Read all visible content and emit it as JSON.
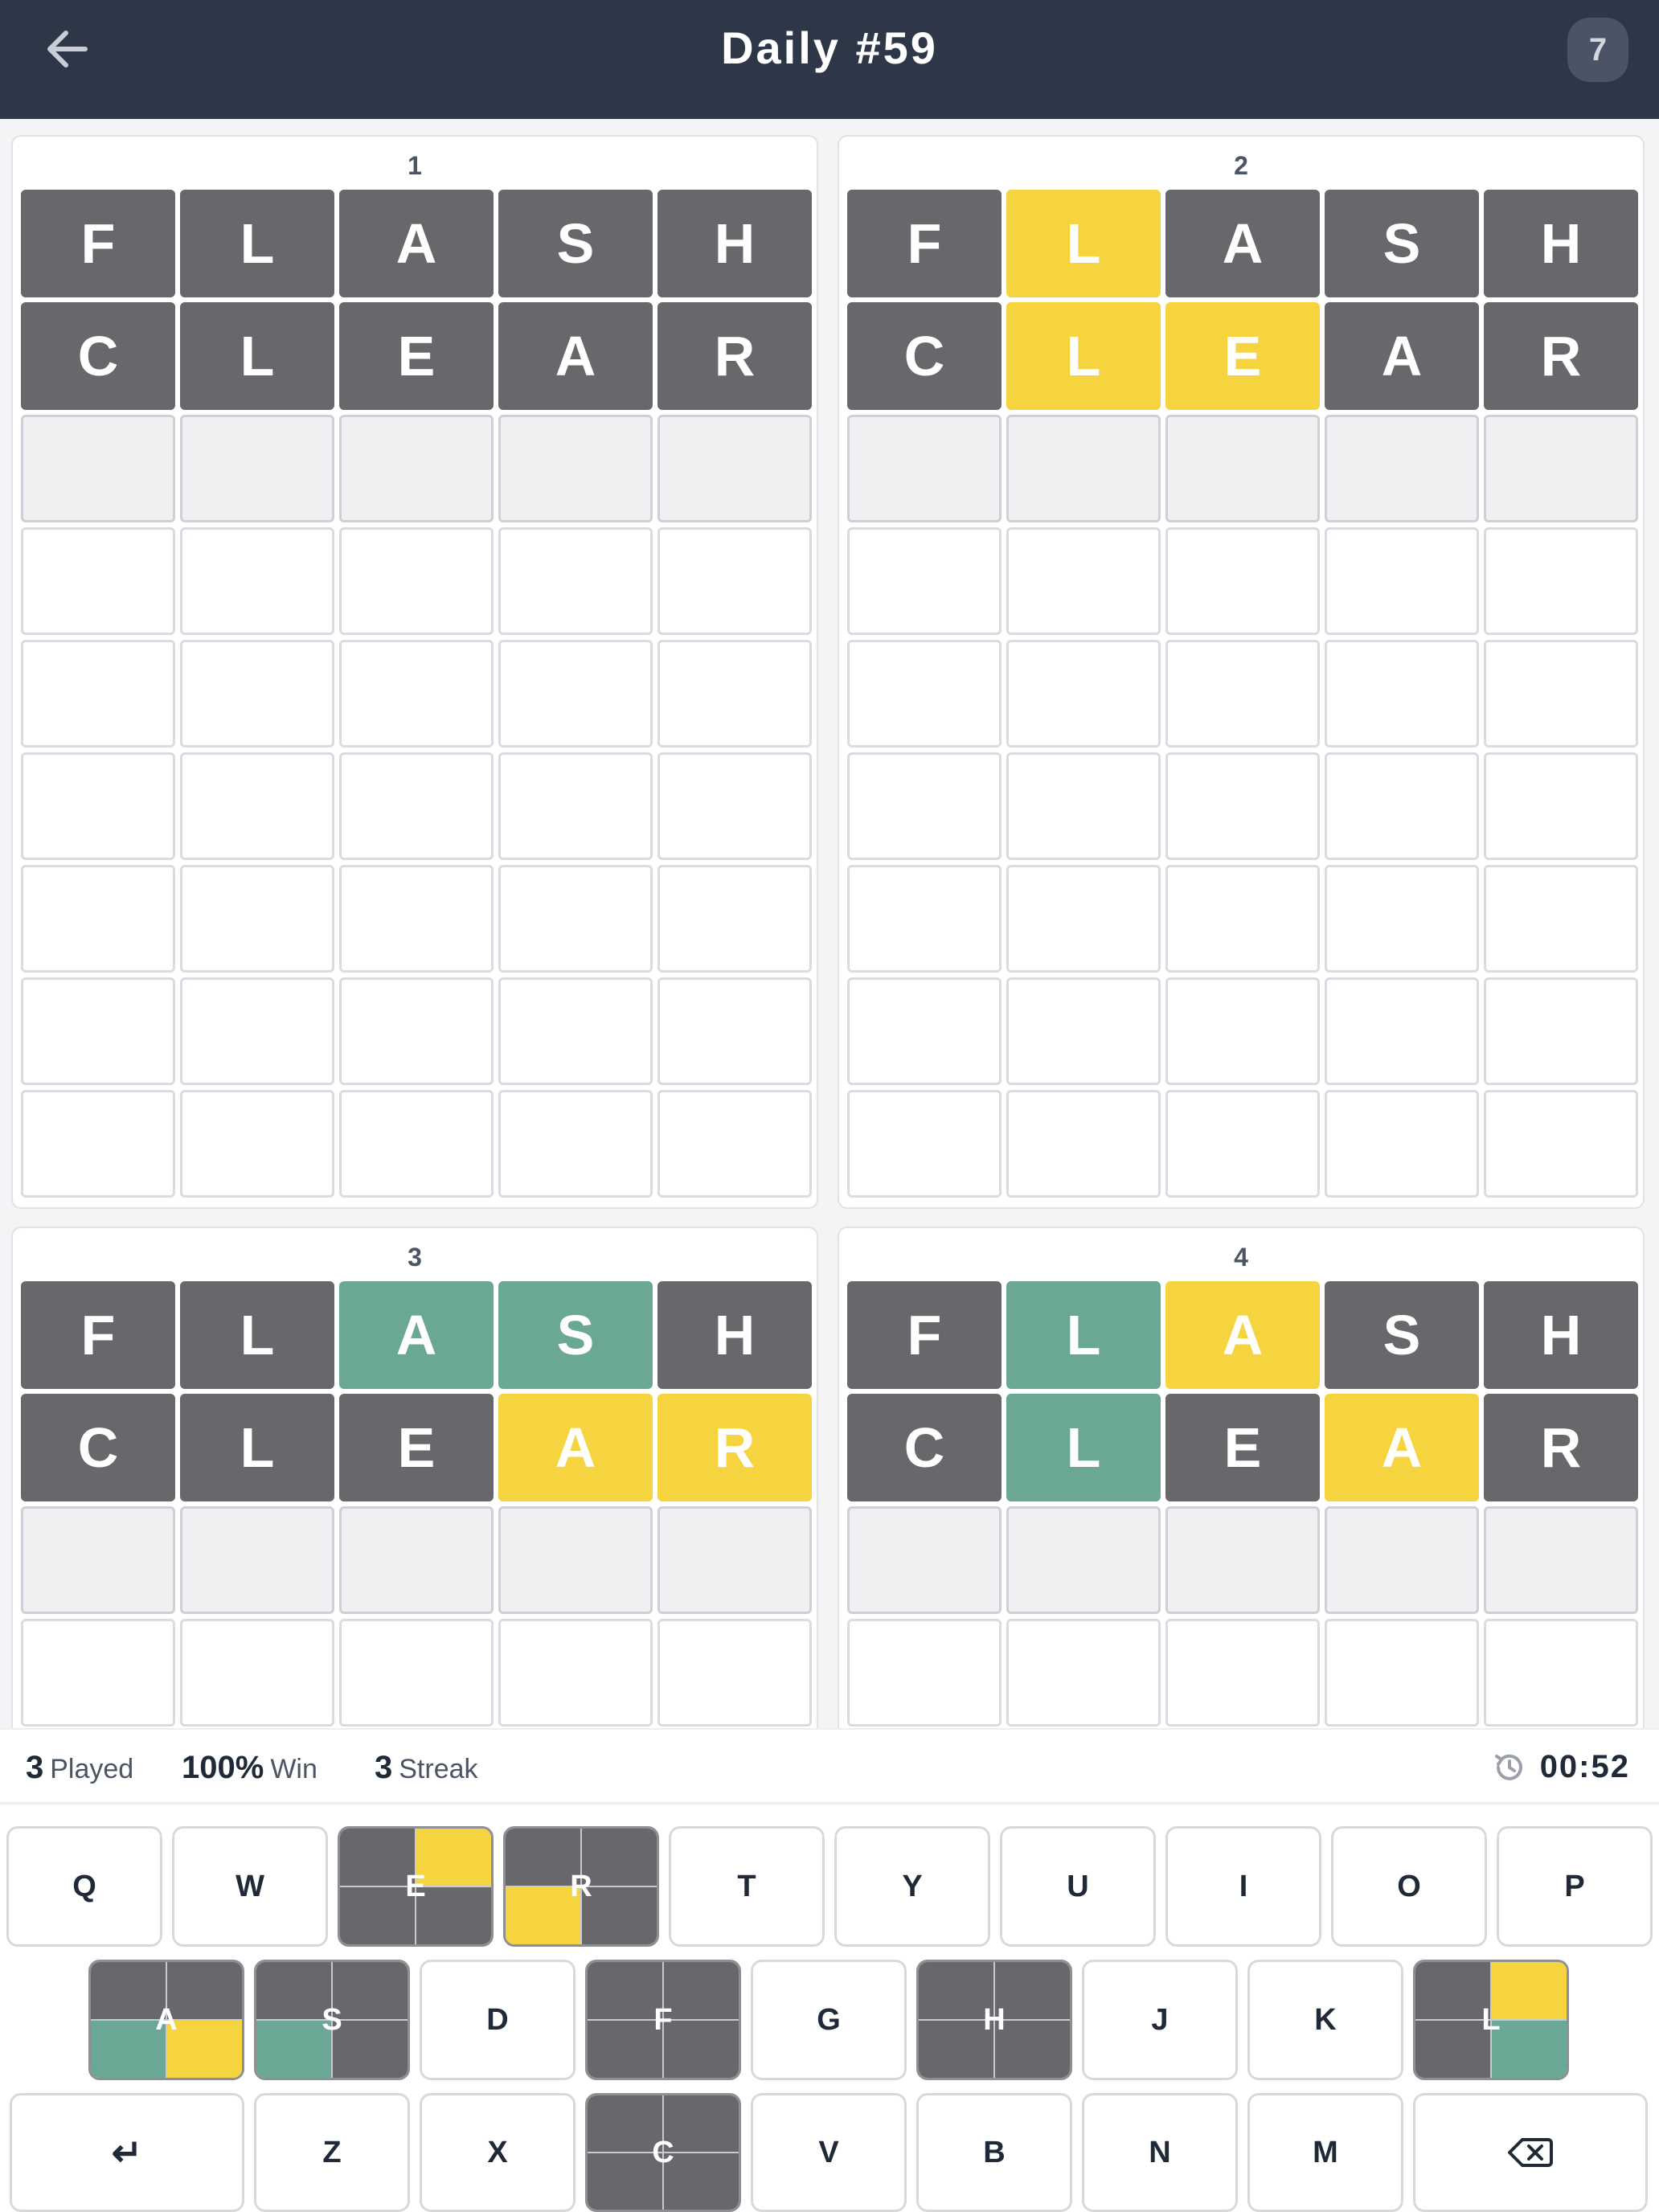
{
  "header": {
    "title": "Daily #59",
    "badge": "7",
    "back_icon": "arrow-left-icon"
  },
  "colors": {
    "gray": "#68686c",
    "yellow": "#f6d440",
    "green": "#6aa895",
    "header_bg": "#2e3748"
  },
  "boards": [
    {
      "number": "1",
      "rows": [
        {
          "letters": [
            "F",
            "L",
            "A",
            "S",
            "H"
          ],
          "states": [
            "gray",
            "gray",
            "gray",
            "gray",
            "gray"
          ]
        },
        {
          "letters": [
            "C",
            "L",
            "E",
            "A",
            "R"
          ],
          "states": [
            "gray",
            "gray",
            "gray",
            "gray",
            "gray"
          ]
        }
      ],
      "current_row": 2,
      "total_rows": 9
    },
    {
      "number": "2",
      "rows": [
        {
          "letters": [
            "F",
            "L",
            "A",
            "S",
            "H"
          ],
          "states": [
            "gray",
            "yellow",
            "gray",
            "gray",
            "gray"
          ]
        },
        {
          "letters": [
            "C",
            "L",
            "E",
            "A",
            "R"
          ],
          "states": [
            "gray",
            "yellow",
            "yellow",
            "gray",
            "gray"
          ]
        }
      ],
      "current_row": 2,
      "total_rows": 9
    },
    {
      "number": "3",
      "rows": [
        {
          "letters": [
            "F",
            "L",
            "A",
            "S",
            "H"
          ],
          "states": [
            "gray",
            "gray",
            "green",
            "green",
            "gray"
          ]
        },
        {
          "letters": [
            "C",
            "L",
            "E",
            "A",
            "R"
          ],
          "states": [
            "gray",
            "gray",
            "gray",
            "yellow",
            "yellow"
          ]
        }
      ],
      "current_row": 2,
      "total_rows": 4
    },
    {
      "number": "4",
      "rows": [
        {
          "letters": [
            "F",
            "L",
            "A",
            "S",
            "H"
          ],
          "states": [
            "gray",
            "green",
            "yellow",
            "gray",
            "gray"
          ]
        },
        {
          "letters": [
            "C",
            "L",
            "E",
            "A",
            "R"
          ],
          "states": [
            "gray",
            "green",
            "gray",
            "yellow",
            "gray"
          ]
        }
      ],
      "current_row": 2,
      "total_rows": 4
    }
  ],
  "stats": {
    "played_value": "3",
    "played_label": "Played",
    "win_value": "100%",
    "win_label": "Win",
    "streak_value": "3",
    "streak_label": "Streak",
    "timer": "00:52",
    "timer_icon": "history-icon"
  },
  "keyboard": {
    "rows": [
      [
        {
          "key": "Q"
        },
        {
          "key": "W"
        },
        {
          "key": "E",
          "quads": [
            "gray",
            "yellow",
            "gray",
            "gray"
          ]
        },
        {
          "key": "R",
          "quads": [
            "gray",
            "gray",
            "yellow",
            "gray"
          ]
        },
        {
          "key": "T"
        },
        {
          "key": "Y"
        },
        {
          "key": "U"
        },
        {
          "key": "I"
        },
        {
          "key": "O"
        },
        {
          "key": "P"
        }
      ],
      [
        {
          "key": "A",
          "quads": [
            "gray",
            "gray",
            "green",
            "yellow"
          ]
        },
        {
          "key": "S",
          "quads": [
            "gray",
            "gray",
            "green",
            "gray"
          ]
        },
        {
          "key": "D"
        },
        {
          "key": "F",
          "quads": [
            "gray",
            "gray",
            "gray",
            "gray"
          ]
        },
        {
          "key": "G"
        },
        {
          "key": "H",
          "quads": [
            "gray",
            "gray",
            "gray",
            "gray"
          ]
        },
        {
          "key": "J"
        },
        {
          "key": "K"
        },
        {
          "key": "L",
          "quads": [
            "gray",
            "yellow",
            "gray",
            "green"
          ]
        }
      ],
      [
        {
          "key": "↵",
          "icon": "enter-icon"
        },
        {
          "key": "Z"
        },
        {
          "key": "X"
        },
        {
          "key": "C",
          "quads": [
            "gray",
            "gray",
            "gray",
            "gray"
          ]
        },
        {
          "key": "V"
        },
        {
          "key": "B"
        },
        {
          "key": "N"
        },
        {
          "key": "M"
        },
        {
          "key": "",
          "icon": "backspace-icon"
        }
      ]
    ]
  }
}
